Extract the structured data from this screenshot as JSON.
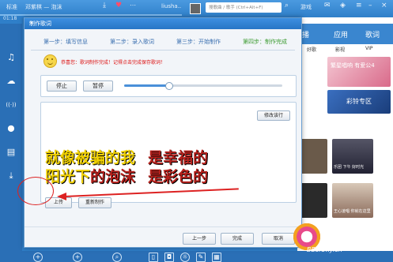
{
  "player": {
    "mode_label": "标准",
    "track_text": "邓紫棋 — 泡沫",
    "elapsed": "01:18",
    "username": "liusha..",
    "search_placeholder": "搜歌曲 / 歌手 (Ctrl+Alt+F)",
    "game_label": "游戏"
  },
  "sidebar": {
    "items": [
      {
        "icon": "music-note-icon",
        "glyph": "♫"
      },
      {
        "icon": "cloud-icon",
        "glyph": "☁"
      },
      {
        "icon": "broadcast-icon",
        "glyph": "((·))"
      },
      {
        "icon": "location-pin-icon",
        "glyph": "⬤"
      },
      {
        "icon": "document-icon",
        "glyph": "▤"
      },
      {
        "icon": "download-icon",
        "glyph": "⤓"
      }
    ]
  },
  "right_panel": {
    "tabs": [
      "播",
      "应用",
      "歌词"
    ],
    "subtabs": [
      "好歌",
      "影视",
      "VIP"
    ],
    "cards": [
      {
        "caption": "繁星唱响 有爱公4"
      },
      {
        "caption": "彩铃专区"
      },
      {
        "caption": "乐团 下午 好时光"
      },
      {
        "caption": "王心凌唱 你就在这里"
      }
    ]
  },
  "dialog": {
    "title": "制作歌词",
    "close_glyph": "×",
    "steps": [
      {
        "label": "第一步：填写信息",
        "active": false
      },
      {
        "label": "第二步：录入歌词",
        "active": false
      },
      {
        "label": "第三步：开始制作",
        "active": false
      },
      {
        "label": "第四步：制作完成",
        "active": true
      }
    ],
    "notice": "恭喜您：歌词制作完成！记得点击完成保存歌词！",
    "stop_label": "停止",
    "pause_label": "暂停",
    "slider_progress": 0.28,
    "edit_line_label": "修改该行",
    "lyric_line1_sung": "就像被骗的我",
    "lyric_line1_rest": "是幸福的",
    "lyric_line2_sung": "阳光下",
    "lyric_line2_rest": "的泡沫",
    "lyric_line2_end": "是彩色的",
    "upload_label": "上传",
    "remake_label": "重新制作",
    "prev_label": "上一步",
    "finish_label": "完成",
    "cancel_label": "取消"
  },
  "watermark": "BBs.Oxy.cn",
  "colors": {
    "brand_blue": "#2f7fc9",
    "lyric_red": "#b4201b",
    "lyric_highlight": "#f0d000",
    "annotation_red": "#d22222",
    "step_active": "#3a9a2e"
  }
}
